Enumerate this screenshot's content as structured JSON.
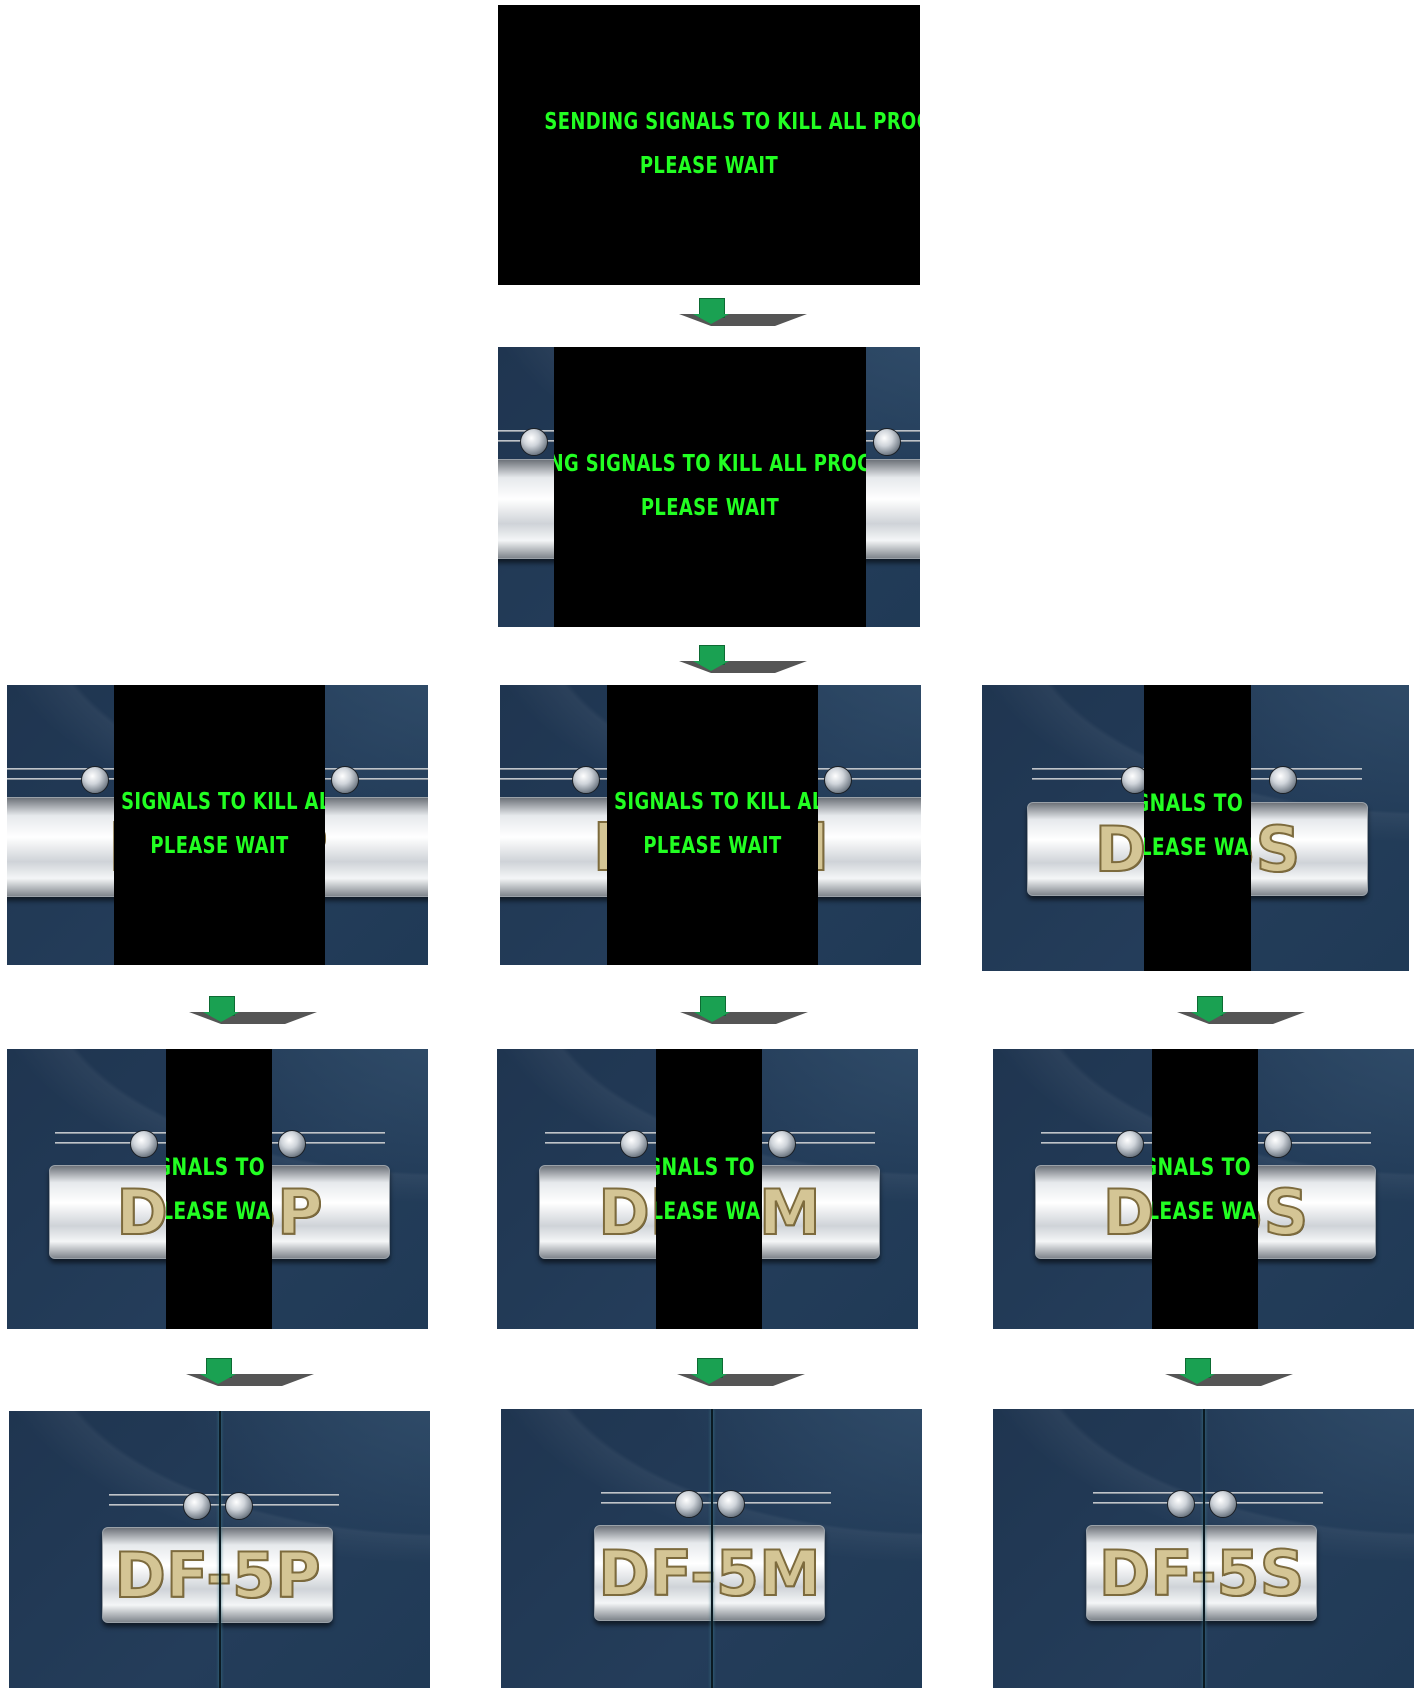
{
  "message": {
    "line1": "SENDING SIGNALS TO KILL ALL PROCESSES",
    "line2": "PLEASE WAIT"
  },
  "models": [
    "DF-5P",
    "DF-5M",
    "DF-5S"
  ],
  "colors": {
    "text_green": "#22ff22",
    "background_navy": "#243d5a",
    "arrow_green": "#1aa152"
  },
  "icons": {
    "arrow": "down-arrow-icon",
    "knob": "knob-icon"
  }
}
